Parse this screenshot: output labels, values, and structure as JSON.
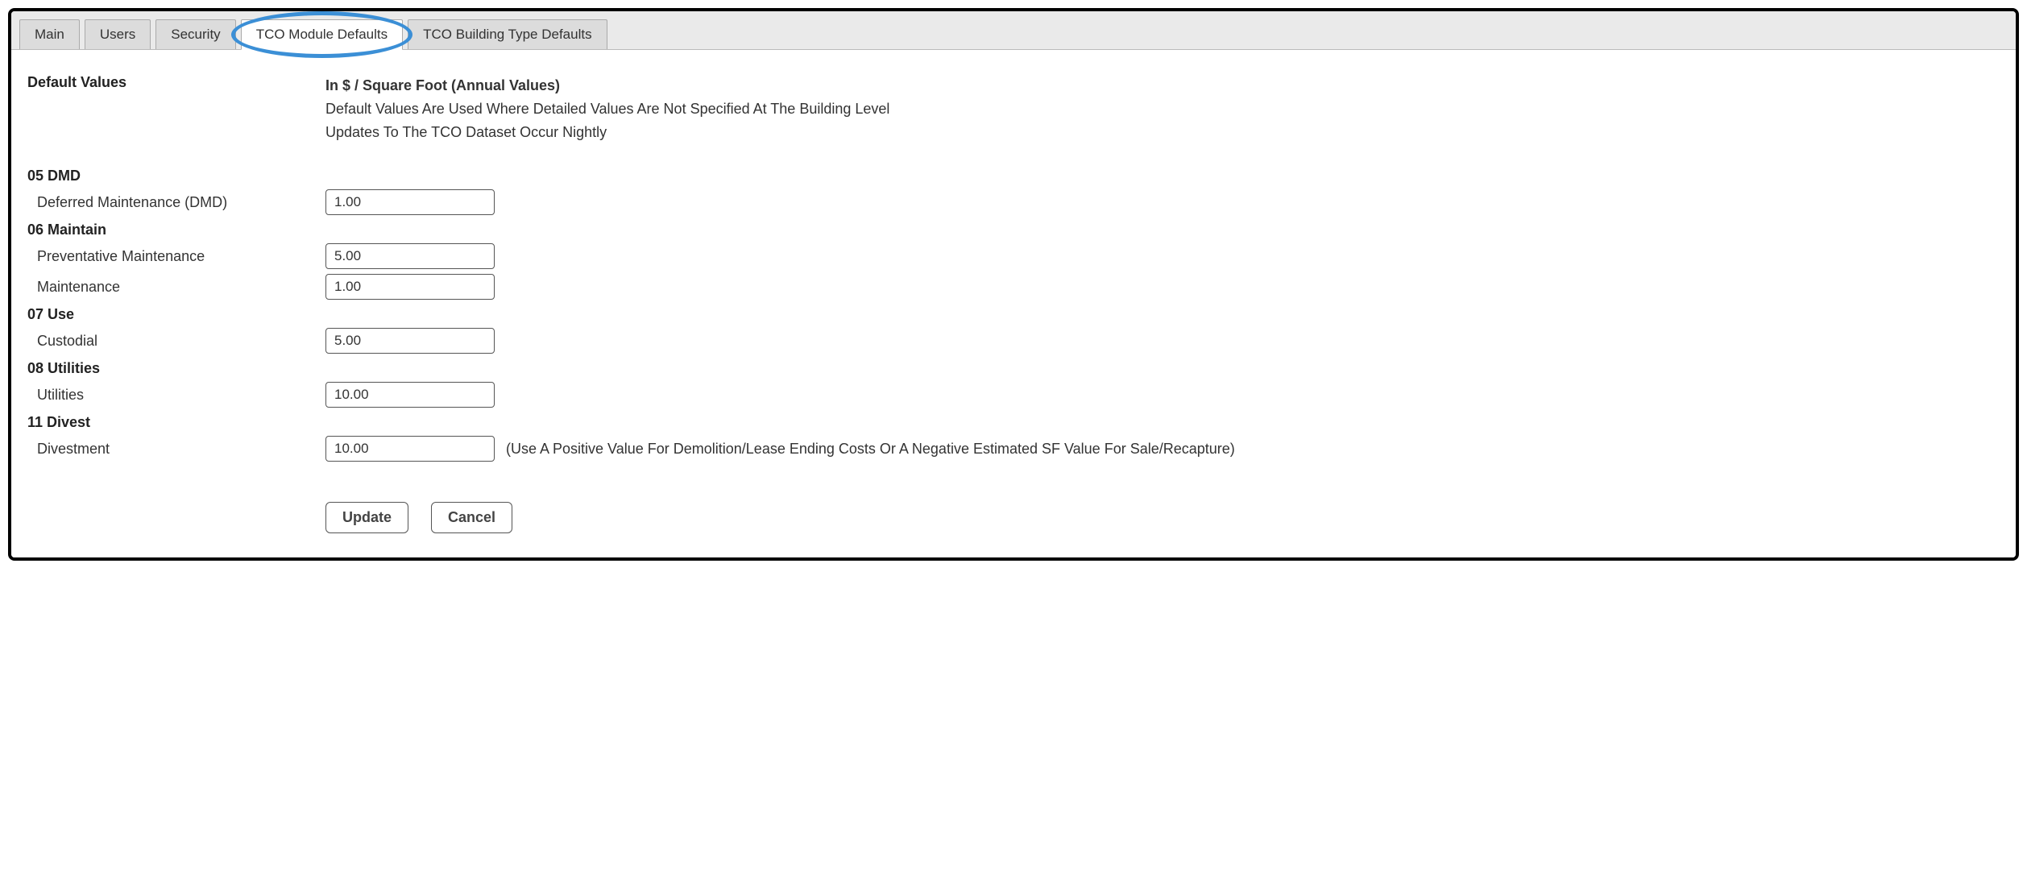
{
  "tabs": [
    {
      "label": "Main",
      "active": false
    },
    {
      "label": "Users",
      "active": false
    },
    {
      "label": "Security",
      "active": false
    },
    {
      "label": "TCO Module Defaults",
      "active": true
    },
    {
      "label": "TCO Building Type Defaults",
      "active": false
    }
  ],
  "header": {
    "title": "Default Values",
    "line1": "In $ / Square Foot (Annual Values)",
    "line2": "Default Values Are Used Where Detailed Values Are Not Specified At The Building Level",
    "line3": "Updates To The TCO Dataset Occur Nightly"
  },
  "groups": [
    {
      "title": "05 DMD",
      "fields": [
        {
          "label": "Deferred Maintenance (DMD)",
          "value": "1.00",
          "hint": ""
        }
      ]
    },
    {
      "title": "06 Maintain",
      "fields": [
        {
          "label": "Preventative Maintenance",
          "value": "5.00",
          "hint": ""
        },
        {
          "label": "Maintenance",
          "value": "1.00",
          "hint": ""
        }
      ]
    },
    {
      "title": "07 Use",
      "fields": [
        {
          "label": "Custodial",
          "value": "5.00",
          "hint": ""
        }
      ]
    },
    {
      "title": "08 Utilities",
      "fields": [
        {
          "label": "Utilities",
          "value": "10.00",
          "hint": ""
        }
      ]
    },
    {
      "title": "11 Divest",
      "fields": [
        {
          "label": "Divestment",
          "value": "10.00",
          "hint": "(Use A Positive Value For Demolition/Lease Ending Costs Or A Negative Estimated SF Value For Sale/Recapture)"
        }
      ]
    }
  ],
  "buttons": {
    "update": "Update",
    "cancel": "Cancel"
  }
}
